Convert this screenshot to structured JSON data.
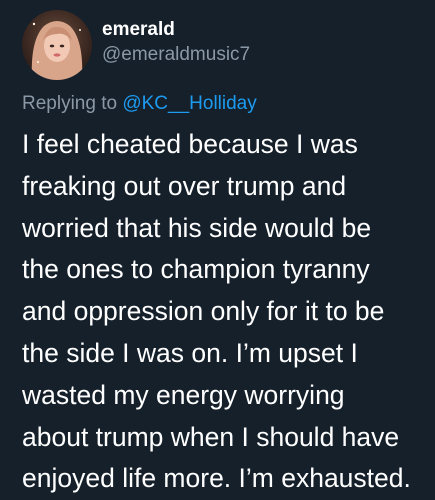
{
  "user": {
    "display_name": "emerald",
    "handle": "@emeraldmusic7",
    "avatar_icon": "profile-photo"
  },
  "reply": {
    "prefix": "Replying to ",
    "mention": "@KC__Holliday"
  },
  "tweet": {
    "lines": [
      "I feel cheated because I was",
      "freaking out over trump and",
      "worried that his side would be",
      "the ones to champion tyranny",
      "and oppression only for it to be",
      "the side I was on. I’m upset I",
      "wasted my energy worrying",
      "about trump when I should have",
      "enjoyed life more. I’m exhausted."
    ]
  },
  "colors": {
    "background": "#15202b",
    "text": "#ffffff",
    "secondary": "#8b98a5",
    "accent": "#1d9bf0"
  }
}
